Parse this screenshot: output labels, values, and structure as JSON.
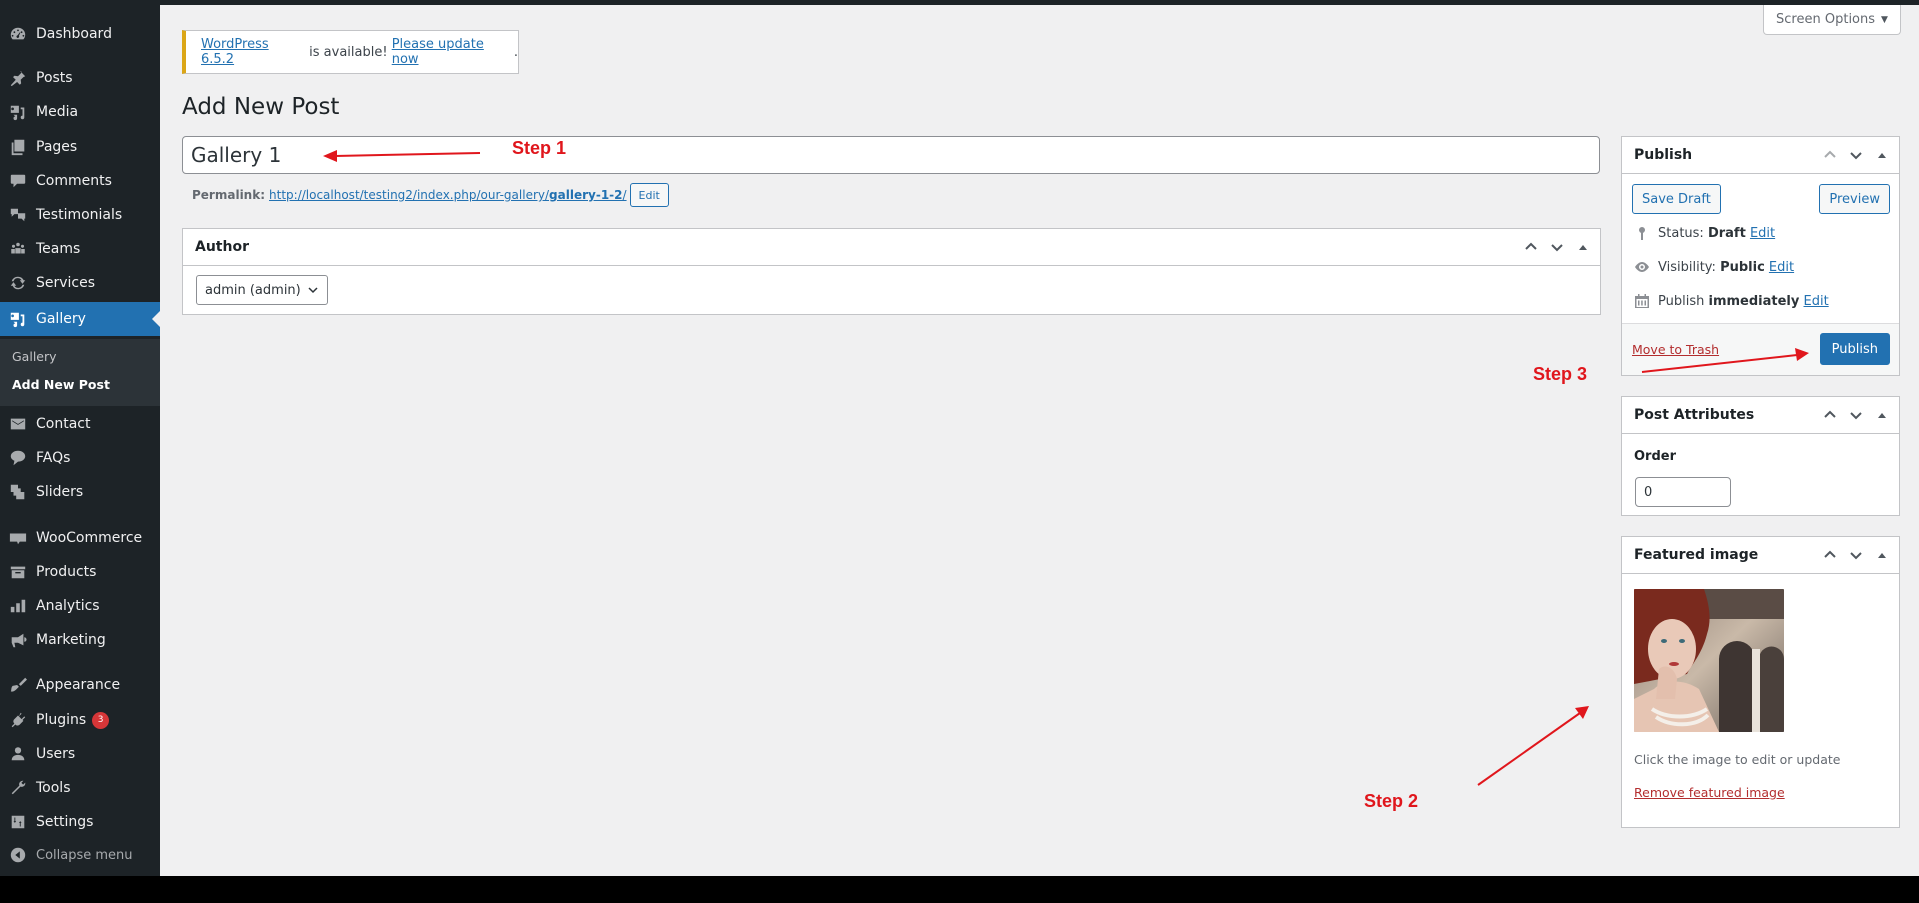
{
  "sidebar": {
    "items": [
      {
        "label": "Dashboard",
        "icon": "dashboard-icon"
      },
      {
        "label": "Posts",
        "icon": "pin-icon"
      },
      {
        "label": "Media",
        "icon": "media-icon"
      },
      {
        "label": "Pages",
        "icon": "pages-icon"
      },
      {
        "label": "Comments",
        "icon": "comment-icon"
      },
      {
        "label": "Testimonials",
        "icon": "testimonials-icon"
      },
      {
        "label": "Teams",
        "icon": "groups-icon"
      },
      {
        "label": "Services",
        "icon": "update-icon"
      },
      {
        "label": "Gallery",
        "icon": "media-icon",
        "active": true
      },
      {
        "label": "Contact",
        "icon": "email-icon"
      },
      {
        "label": "FAQs",
        "icon": "format-chat-icon"
      },
      {
        "label": "Sliders",
        "icon": "slides-icon"
      },
      {
        "label": "WooCommerce",
        "icon": "woo-icon"
      },
      {
        "label": "Products",
        "icon": "archive-icon"
      },
      {
        "label": "Analytics",
        "icon": "chart-bar-icon"
      },
      {
        "label": "Marketing",
        "icon": "megaphone-icon"
      },
      {
        "label": "Appearance",
        "icon": "paintbrush-icon"
      },
      {
        "label": "Plugins",
        "icon": "plug-icon",
        "badge": "3"
      },
      {
        "label": "Users",
        "icon": "user-icon"
      },
      {
        "label": "Tools",
        "icon": "wrench-icon"
      },
      {
        "label": "Settings",
        "icon": "settings-icon"
      }
    ],
    "submenu": [
      {
        "label": "Gallery"
      },
      {
        "label": "Add New Post",
        "current": true
      }
    ],
    "collapse_label": "Collapse menu"
  },
  "header": {
    "screen_options_label": "Screen Options"
  },
  "notice": {
    "version_link": "WordPress 6.5.2",
    "middle_text": " is available! ",
    "update_link": "Please update now",
    "end_text": "."
  },
  "page_title": "Add New Post",
  "post": {
    "title_value": "Gallery 1",
    "permalink_label": "Permalink:",
    "permalink_base": "http://localhost/testing2/index.php/our-gallery/",
    "permalink_slug": "gallery-1-2",
    "permalink_trailing": "/",
    "permalink_edit": "Edit"
  },
  "author_box": {
    "title": "Author",
    "selected": "admin (admin)"
  },
  "publish_box": {
    "title": "Publish",
    "save_draft": "Save Draft",
    "preview": "Preview",
    "status_label": "Status:",
    "status_value": "Draft",
    "visibility_label": "Visibility:",
    "visibility_value": "Public",
    "publish_label": "Publish",
    "publish_value": "immediately",
    "edit_label": "Edit",
    "trash_label": "Move to Trash",
    "publish_button": "Publish"
  },
  "attributes_box": {
    "title": "Post Attributes",
    "order_label": "Order",
    "order_value": "0"
  },
  "featured_box": {
    "title": "Featured image",
    "help_text": "Click the image to edit or update",
    "remove_label": "Remove featured image"
  },
  "annotations": {
    "step1": "Step 1",
    "step2": "Step 2",
    "step3": "Step 3",
    "color": "#e0161c"
  },
  "colors": {
    "accent": "#2271b1",
    "sidebar_bg": "#1d2327",
    "notice_border": "#dba617",
    "badge": "#d63638",
    "danger_link": "#b32d2e"
  }
}
